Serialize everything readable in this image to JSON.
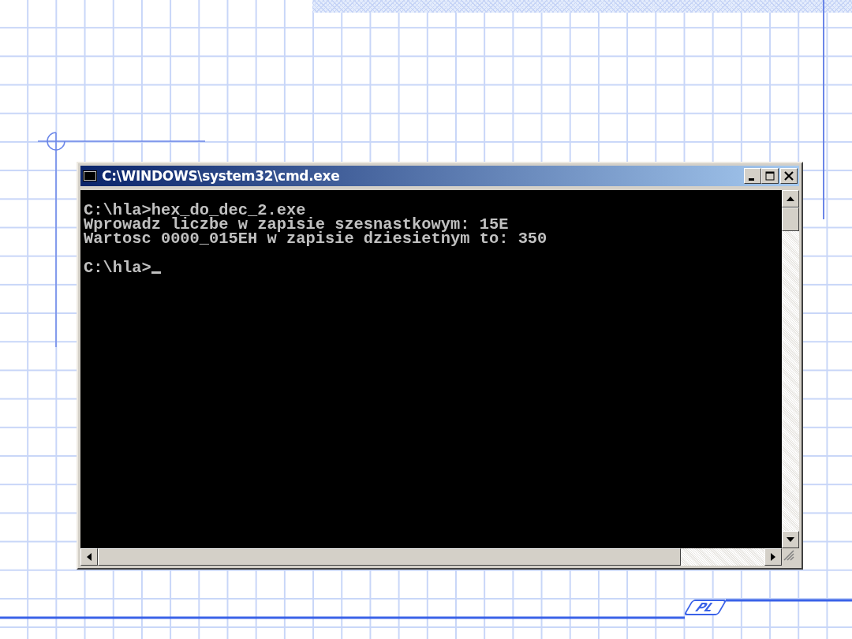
{
  "window": {
    "title": "C:\\WINDOWS\\system32\\cmd.exe",
    "buttons": [
      {
        "kind": "minimize"
      },
      {
        "kind": "maximize"
      },
      {
        "kind": "close"
      }
    ]
  },
  "console": {
    "blocks": [
      [
        "C:\\hla>hex_do_dec_2.exe",
        "Wprowadz liczbe w zapisie szesnastkowym: 15E",
        "Wartosc 0000_015EH w zapisie dziesietnym to: 350"
      ],
      [
        "C:\\hla>"
      ]
    ],
    "cursor": true
  },
  "logo": {
    "text": "PL"
  }
}
